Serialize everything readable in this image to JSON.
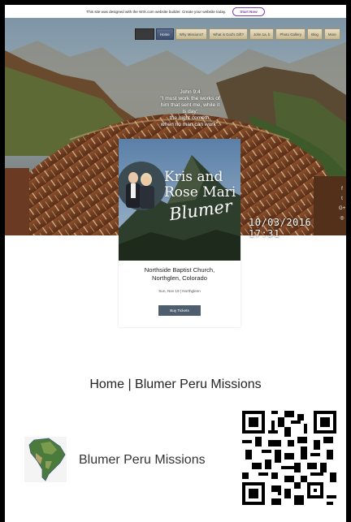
{
  "wix_banner": {
    "message": "This site was designed with the WIX.com website builder. Create your website today.",
    "button": "Start Now"
  },
  "nav": {
    "items": [
      {
        "label": "Home",
        "active": true
      },
      {
        "label": "Why Missions?",
        "active": false
      },
      {
        "label": "What is God's Gift?",
        "active": false
      },
      {
        "label": "John 1a, b",
        "active": false
      },
      {
        "label": "Photo Gallery",
        "active": false
      },
      {
        "label": "Blog",
        "active": false
      },
      {
        "label": "More",
        "active": false
      }
    ]
  },
  "verse": {
    "ref": "John 9:4",
    "line1": "\"I must work the works of",
    "line2": "him that sent me, while it",
    "line3": "is day:",
    "line4": "the night cometh,",
    "line5": "when no man can work\"."
  },
  "social": [
    "f",
    "t",
    "G+",
    "◎"
  ],
  "event": {
    "title_line1": "Kris and",
    "title_line2": "Rose Mari",
    "script": "Blumer",
    "church_line1": "Northside Baptist Church,",
    "church_line2": "Northglen, Colorado",
    "date": "Sun, Nov 19 | Northglenn",
    "button": "Buy Tickets"
  },
  "timestamp": "10/03/2016  17:31",
  "page_title": "Home | Blumer Peru Missions",
  "site_name": "Blumer Peru Missions",
  "colors": {
    "nav_active": "#4a5a78",
    "ticket_button": "#4e5e6e",
    "wix_accent": "#7e3fa6"
  }
}
